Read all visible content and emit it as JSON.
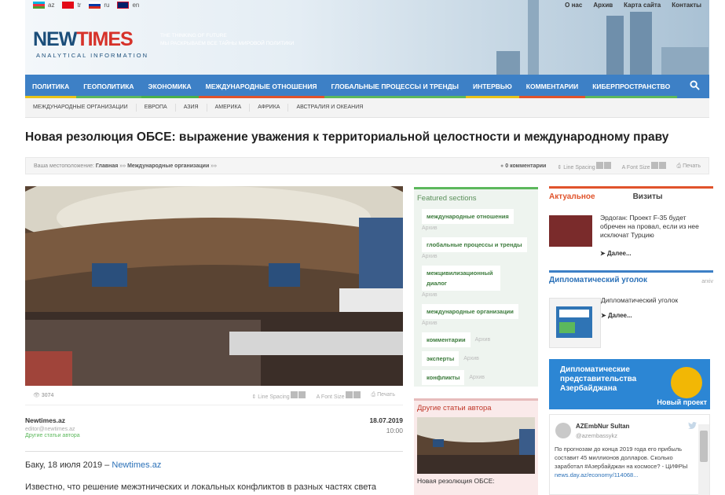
{
  "header": {
    "languages": [
      {
        "code": "az",
        "flag": "azerbaijan-flag"
      },
      {
        "code": "tr",
        "flag": "turkey-flag"
      },
      {
        "code": "ru",
        "flag": "russia-flag"
      },
      {
        "code": "en",
        "flag": "uk-flag"
      }
    ],
    "top_links": [
      "О нас",
      "Архив",
      "Карта сайта",
      "Контакты"
    ],
    "logo_new": "NEW",
    "logo_times": "TIMES",
    "logo_sub": "ANALYTICAL INFORMATION",
    "tagline_1": "THE THINKING OF FUTURE",
    "tagline_2": "МЫ РАСКРЫВАЕМ ВСЕ ТАЙНЫ МИРОВОЙ ПОЛИТИКИ"
  },
  "nav": {
    "items": [
      "ПОЛИТИКА",
      "ГЕОПОЛИТИКА",
      "ЭКОНОМИКА",
      "МЕЖДУНАРОДНЫЕ ОТНОШЕНИЯ",
      "ГЛОБАЛЬНЫЕ ПРОЦЕССЫ И ТРЕНДЫ",
      "ИНТЕРВЬЮ",
      "КОММЕНТАРИИ",
      "КИБЕРПРОСТРАНСТВО"
    ],
    "search_icon": "search-icon"
  },
  "subnav": {
    "items": [
      "МЕЖДУНАРОДНЫЕ ОРГАНИЗАЦИИ",
      "ЕВРОПА",
      "АЗИЯ",
      "АМЕРИКА",
      "АФРИКА",
      "АВСТРАЛИЯ И ОКЕАНИЯ"
    ]
  },
  "article": {
    "title": "Новая резолюция ОБСЕ: выражение уважения к территориальной целостности и международному праву",
    "breadcrumb_prefix": "Ваша местоположение:",
    "breadcrumb_home": "Главная",
    "breadcrumb_sep": "»»",
    "breadcrumb_section": "Международные организации",
    "comments": "0 комментарии",
    "line_spacing": "Line Spacing",
    "font_size": "Font Size",
    "print": "Печать",
    "views": "3074",
    "author_name": "Newtimes.az",
    "author_email": "editor@newtimes.az",
    "author_other": "Другие статьи автора",
    "date": "18.07.2019",
    "time": "10:00",
    "lead_prefix": "Баку, 18 июля 2019 –",
    "lead_link": "Newtimes.az",
    "body_text": "Известно, что решение межэтнических и локальных конфликтов в разных частях света"
  },
  "featured": {
    "heading": "Featured sections",
    "archive": "Архив",
    "items": [
      "международные отношения",
      "глобальные процессы и тренды",
      "межцивилизационный диалог",
      "международные организации"
    ],
    "inline_items": [
      "комментарии",
      "эксперты",
      "конфликты"
    ]
  },
  "other_articles": {
    "heading": "Другие статьи автора",
    "caption": "Новая резолюция ОБСЕ:"
  },
  "sidebar": {
    "tab_active": "Актуальное",
    "tab_other": "Визиты",
    "news_text": "Эрдоган: Проект F-35 будет обречен на провал, если из нее исключат Турцию",
    "more": "Далее...",
    "dip_heading": "Дипломатический уголок",
    "dip_archive": "arxiv",
    "dip_text": "Дипломатический уголок",
    "banner_text": "Дипломатические представительства Азербайджана",
    "banner_new": "Новый проект",
    "tweet_name": "AZEmbNur Sultan",
    "tweet_handle": "@azembassykz",
    "tweet_body": "По прогнозам до конца 2019 года его прибыль составит 45 миллионов долларов. Сколько заработал #Азербайджан на космосе? - ЦИФРЫ",
    "tweet_link": "news.day.az/economy/114068..."
  },
  "colors": {
    "nav_blue": "#3d80c6",
    "brand_red": "#d6322a",
    "accent_green": "#5cb85c",
    "accent_orange": "#e0532b"
  }
}
